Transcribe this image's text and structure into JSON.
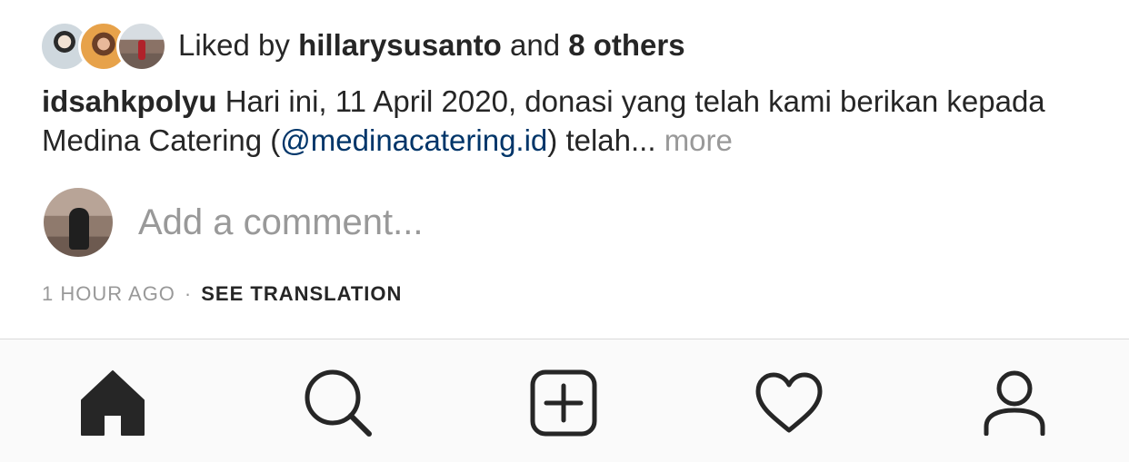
{
  "likes": {
    "prefix": "Liked by ",
    "user": "hillarysusanto",
    "connector": " and ",
    "others": "8 others",
    "avatar_icons": [
      "liker-avatar-1",
      "liker-avatar-2",
      "liker-avatar-3"
    ]
  },
  "caption": {
    "username": "idsahkpolyu",
    "text_before": " Hari ini, 11 April 2020, donasi yang telah kami berikan kepada Medina Catering (",
    "mention": "@medinacatering.id",
    "text_after": ") telah... ",
    "more": "more"
  },
  "comment": {
    "placeholder": "Add a comment..."
  },
  "meta": {
    "time": "1 HOUR AGO",
    "separator": "·",
    "translation": "SEE TRANSLATION"
  },
  "tabbar": {
    "items": [
      {
        "icon": "home-icon",
        "active": true
      },
      {
        "icon": "search-icon",
        "active": false
      },
      {
        "icon": "new-post-icon",
        "active": false
      },
      {
        "icon": "heart-icon",
        "active": false
      },
      {
        "icon": "profile-icon",
        "active": false
      }
    ]
  },
  "colors": {
    "text": "#262626",
    "secondary": "#999999",
    "link": "#003569",
    "tabbar_bg": "#fafafa",
    "divider": "#dbdbdb"
  }
}
